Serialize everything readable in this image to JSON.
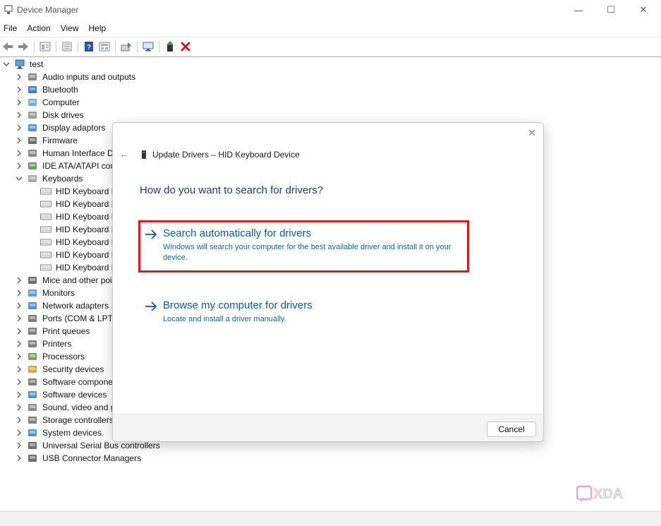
{
  "window": {
    "title": "Device Manager",
    "minimize_glyph": "—",
    "maximize_glyph": "☐",
    "close_glyph": "✕"
  },
  "menu": [
    "File",
    "Action",
    "View",
    "Help"
  ],
  "toolbar_icons": [
    "back-icon",
    "forward-icon",
    "properties-icon",
    "show-hide-icon",
    "help-icon",
    "details-icon",
    "update-driver-icon",
    "scan-hardware-icon",
    "enable-device-icon",
    "uninstall-icon"
  ],
  "tree": {
    "root": "test",
    "items": [
      {
        "label": "Audio inputs and outputs",
        "icon": "speaker-icon",
        "expanded": false
      },
      {
        "label": "Bluetooth",
        "icon": "bluetooth-icon",
        "expanded": false
      },
      {
        "label": "Computer",
        "icon": "computer-icon",
        "expanded": false
      },
      {
        "label": "Disk drives",
        "icon": "disk-icon",
        "expanded": false
      },
      {
        "label": "Display adaptors",
        "icon": "display-icon",
        "expanded": false
      },
      {
        "label": "Firmware",
        "icon": "firmware-icon",
        "expanded": false
      },
      {
        "label": "Human Interface D",
        "icon": "hid-icon",
        "expanded": false
      },
      {
        "label": "IDE ATA/ATAPI cont",
        "icon": "ide-icon",
        "expanded": false
      },
      {
        "label": "Keyboards",
        "icon": "keyboard-icon",
        "expanded": true
      },
      {
        "label": "Mice and other poi",
        "icon": "mouse-icon",
        "expanded": false
      },
      {
        "label": "Monitors",
        "icon": "monitor-icon",
        "expanded": false
      },
      {
        "label": "Network adapters",
        "icon": "network-icon",
        "expanded": false
      },
      {
        "label": "Ports (COM & LPT)",
        "icon": "port-icon",
        "expanded": false
      },
      {
        "label": "Print queues",
        "icon": "printer-icon",
        "expanded": false
      },
      {
        "label": "Printers",
        "icon": "printer-icon",
        "expanded": false
      },
      {
        "label": "Processors",
        "icon": "cpu-icon",
        "expanded": false
      },
      {
        "label": "Security devices",
        "icon": "security-icon",
        "expanded": false
      },
      {
        "label": "Software compone",
        "icon": "software-component-icon",
        "expanded": false
      },
      {
        "label": "Software devices",
        "icon": "software-device-icon",
        "expanded": false
      },
      {
        "label": "Sound, video and g",
        "icon": "sound-icon",
        "expanded": false
      },
      {
        "label": "Storage controllers",
        "icon": "storage-icon",
        "expanded": false
      },
      {
        "label": "System devices",
        "icon": "system-icon",
        "expanded": false
      },
      {
        "label": "Universal Serial Bus controllers",
        "icon": "usb-icon",
        "expanded": false
      },
      {
        "label": "USB Connector Managers",
        "icon": "usb-icon",
        "expanded": false
      }
    ],
    "keyboard_children": [
      "HID Keyboard D",
      "HID Keyboard D",
      "HID Keyboard D",
      "HID Keyboard D",
      "HID Keyboard D",
      "HID Keyboard D",
      "HID Keyboard D"
    ]
  },
  "dialog": {
    "title": "Update Drivers – HID Keyboard Device",
    "question": "How do you want to search for drivers?",
    "options": [
      {
        "title": "Search automatically for drivers",
        "description": "Windows will search your computer for the best available driver and install it on your device."
      },
      {
        "title": "Browse my computer for drivers",
        "description": "Locate and install a driver manually."
      }
    ],
    "cancel_label": "Cancel",
    "close_glyph": "✕",
    "back_glyph": "←"
  },
  "colors": {
    "link_blue": "#0a5ba8",
    "highlight_red": "#d41e1e"
  },
  "watermark": {
    "text": "XDA"
  }
}
